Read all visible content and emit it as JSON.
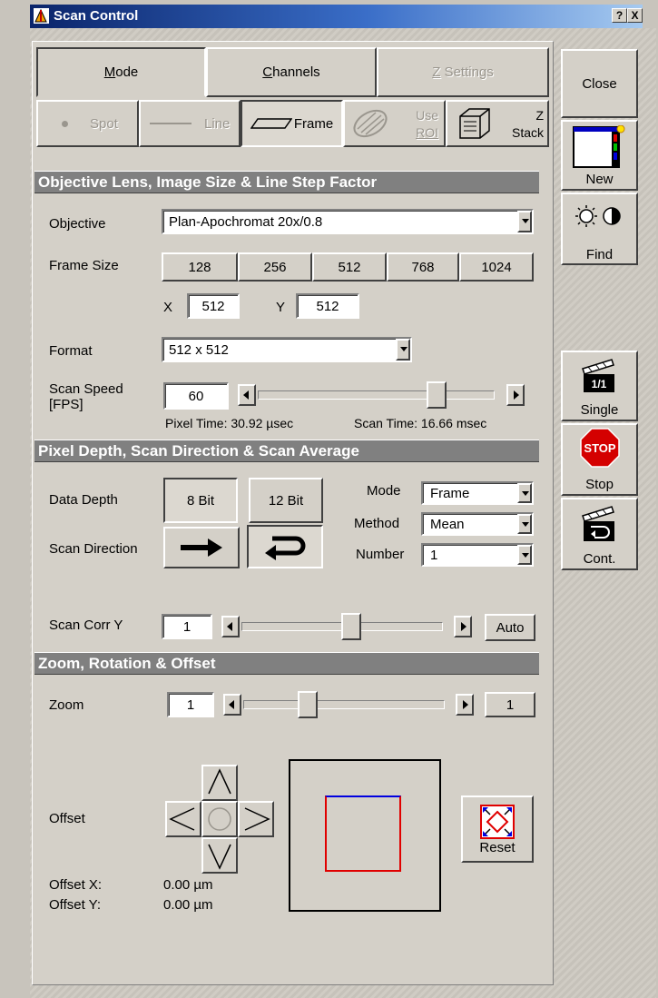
{
  "window": {
    "title": "Scan Control",
    "help_btn": "?",
    "close_btn": "X"
  },
  "tabs": [
    {
      "label": "Mode",
      "underline": "M",
      "rest": "ode"
    },
    {
      "label": "Channels",
      "underline": "C",
      "rest": "hannels"
    },
    {
      "label": "Z Settings",
      "underline": "Z",
      "rest": " Settings"
    }
  ],
  "scan_modes": {
    "spot": "Spot",
    "line": "Line",
    "frame": "Frame",
    "roi_1": "Use",
    "roi_2": "ROI",
    "z_1": "Z",
    "z_2": "Stack"
  },
  "sidebar": {
    "close": "Close",
    "new": "New",
    "find": "Find",
    "single": "Single",
    "single_glyph": "1/1",
    "stop": "Stop",
    "stop_glyph": "STOP",
    "cont": "Cont."
  },
  "section1": {
    "header": "Objective Lens, Image Size & Line Step Factor",
    "objective_label": "Objective",
    "objective_value": "Plan-Apochromat 20x/0.8",
    "frame_size_label": "Frame Size",
    "frame_sizes": [
      "128",
      "256",
      "512",
      "768",
      "1024"
    ],
    "x_label": "X",
    "x_value": "512",
    "y_label": "Y",
    "y_value": "512",
    "format_label": "Format",
    "format_value": "512 x 512",
    "scan_speed_label_1": "Scan Speed",
    "scan_speed_label_2": "[FPS]",
    "scan_speed_value": "60",
    "pixel_time": "Pixel Time: 30.92 µsec",
    "scan_time": "Scan Time: 16.66 msec"
  },
  "section2": {
    "header": "Pixel Depth, Scan Direction & Scan Average",
    "data_depth_label": "Data Depth",
    "bit8": "8 Bit",
    "bit12": "12 Bit",
    "scan_direction_label": "Scan Direction",
    "mode_label": "Mode",
    "mode_value": "Frame",
    "method_label": "Method",
    "method_value": "Mean",
    "number_label": "Number",
    "number_value": "1",
    "scan_corr_label": "Scan Corr Y",
    "scan_corr_value": "1",
    "auto": "Auto"
  },
  "section3": {
    "header": "Zoom, Rotation & Offset",
    "zoom_label": "Zoom",
    "zoom_value": "1",
    "zoom_right_value": "1",
    "offset_label": "Offset",
    "reset": "Reset",
    "offset_x_label": "Offset X:",
    "offset_x_value": "0.00 µm",
    "offset_y_label": "Offset Y:",
    "offset_y_value": "0.00 µm"
  },
  "colors": {
    "title_start": "#0a246a",
    "title_end": "#a6caf0",
    "section_header": "#808080",
    "stop_red": "#d40000",
    "roi_red": "#e00000",
    "roi_blue": "#0000e0"
  },
  "slider_levels": {
    "scan_speed": 0.78,
    "scan_corr": 0.55,
    "zoom": 0.3
  }
}
